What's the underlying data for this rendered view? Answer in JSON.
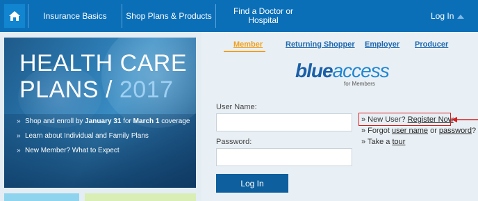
{
  "nav": {
    "home_icon": "home-icon",
    "items": [
      "Insurance Basics",
      "Shop Plans & Products"
    ],
    "find_doctor_line1": "Find a Doctor or",
    "find_doctor_line2": "Hospital",
    "login": "Log In"
  },
  "hero": {
    "title_line1": "HEALTH CARE",
    "title_line2_a": "PLANS / ",
    "title_line2_b": "2017",
    "bullets": [
      {
        "pre": "Shop and enroll by ",
        "b1": "January 31",
        "mid": " for ",
        "b2": "March 1",
        "post": " coverage"
      },
      {
        "text": "Learn about Individual and Family Plans"
      },
      {
        "text": "New Member? What to Expect"
      }
    ]
  },
  "tabs": {
    "member": "Member",
    "returning": "Returning Shopper",
    "employer": "Employer",
    "producer": "Producer"
  },
  "logo": {
    "part1": "blue",
    "part2": "access",
    "sub": "for Members"
  },
  "form": {
    "username_label": "User Name:",
    "password_label": "Password:",
    "login_button": "Log In"
  },
  "links": {
    "new_user_pre": "» New User? ",
    "register": "Register Now",
    "forgot_pre": "» Forgot ",
    "username": "user name",
    "or": " or ",
    "password": "password",
    "q": "?",
    "tour_pre": "» Take a ",
    "tour": "tour"
  },
  "colors": {
    "nav_blue": "#0b6fb8",
    "accent_orange": "#f0a020",
    "highlight_red": "#d91c1c"
  }
}
